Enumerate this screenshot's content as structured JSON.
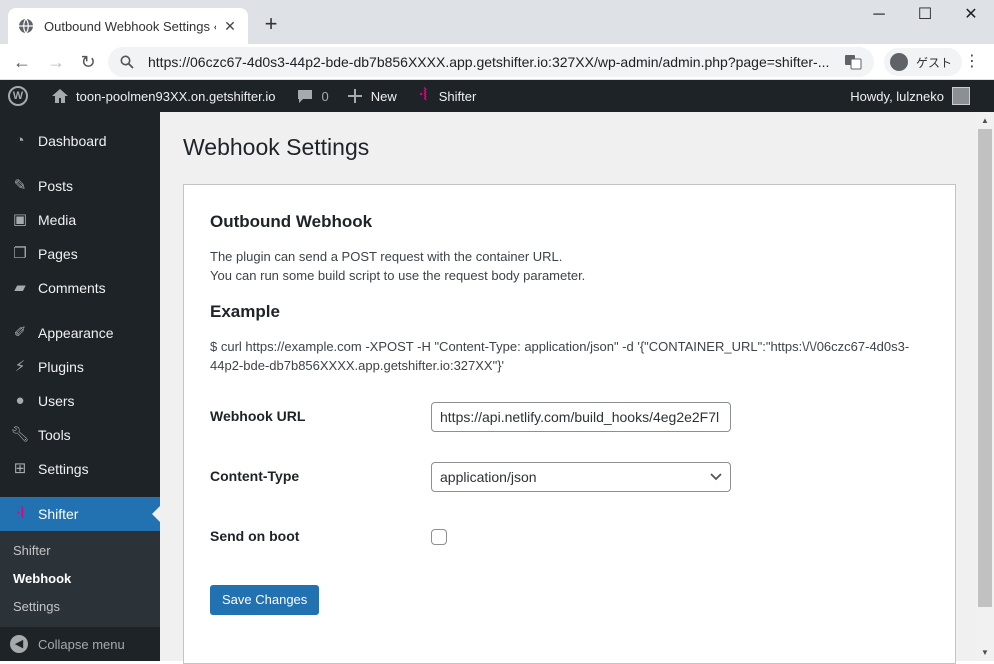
{
  "browser": {
    "tab_title": "Outbound Webhook Settings ‹ kc",
    "new_tab": "+",
    "minimize": "─",
    "maximize": "☐",
    "close": "✕",
    "tab_close": "✕",
    "url": "https://06czc67-4d0s3-44p2-bde-db7b856XXXX.app.getshifter.io:327XX/wp-admin/admin.php?page=shifter-...",
    "profile_label": "ゲスト",
    "back": "←",
    "forward": "→",
    "reload": "↻",
    "menu": "⋮"
  },
  "adminbar": {
    "site_name": "toon-poolmen93XX.on.getshifter.io",
    "comments_count": "0",
    "new_label": "New",
    "shifter_label": "Shifter",
    "howdy": "Howdy, lulzneko"
  },
  "sidebar": {
    "items": [
      {
        "label": "Dashboard",
        "icon": "dashboard-icon"
      },
      {
        "label": "Posts",
        "icon": "pin-icon"
      },
      {
        "label": "Media",
        "icon": "media-icon"
      },
      {
        "label": "Pages",
        "icon": "pages-icon"
      },
      {
        "label": "Comments",
        "icon": "comment-icon"
      },
      {
        "label": "Appearance",
        "icon": "brush-icon"
      },
      {
        "label": "Plugins",
        "icon": "plug-icon"
      },
      {
        "label": "Users",
        "icon": "user-icon"
      },
      {
        "label": "Tools",
        "icon": "wrench-icon"
      },
      {
        "label": "Settings",
        "icon": "settings-icon"
      },
      {
        "label": "Shifter",
        "icon": "shifter-icon"
      }
    ],
    "submenu": [
      "Shifter",
      "Webhook",
      "Settings"
    ],
    "collapse_label": "Collapse menu"
  },
  "main": {
    "page_title": "Webhook Settings",
    "section_title": "Outbound Webhook",
    "desc_line1": "The plugin can send a POST request with the container URL.",
    "desc_line2": "You can run some build script to use the request body parameter.",
    "example_title": "Example",
    "example_line1": "$ curl https://example.com -XPOST -H \"Content-Type: application/json\" -d '{\"CONTAINER_URL\":\"https:\\/\\/06czc67-4d0s3-",
    "example_line2": "44p2-bde-db7b856XXXX.app.getshifter.io:327XX\"}'",
    "webhook_url_label": "Webhook URL",
    "webhook_url_value": "https://api.netlify.com/build_hooks/4eg2e2F7l",
    "content_type_label": "Content-Type",
    "content_type_value": "application/json",
    "send_on_boot_label": "Send on boot",
    "send_on_boot_checked": false,
    "save_label": "Save Changes"
  },
  "colors": {
    "admin_dark": "#1d2327",
    "accent_blue": "#2271b1",
    "shifter_pink": "#e6007e"
  }
}
